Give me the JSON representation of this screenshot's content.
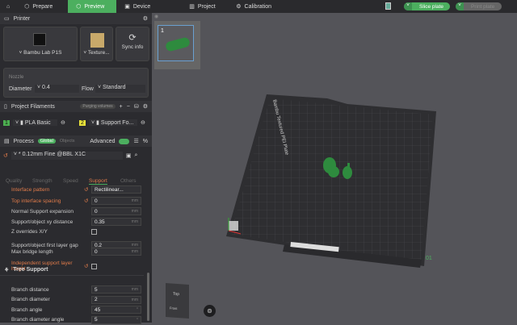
{
  "topbar": {
    "tabs": [
      {
        "label": "Prepare",
        "icon": "cube-icon"
      },
      {
        "label": "Preview",
        "icon": "preview-icon",
        "active": true
      },
      {
        "label": "Device",
        "icon": "device-icon"
      },
      {
        "label": "Project",
        "icon": "project-icon"
      },
      {
        "label": "Calibration",
        "icon": "calibration-icon"
      }
    ],
    "slice_label": "Slice plate",
    "print_label": "Print plate"
  },
  "printer": {
    "title": "Printer",
    "name": "Bambu Lab P1S",
    "plate": "Texture...",
    "sync": "Sync info",
    "nozzle_title": "Nozzle",
    "diameter_label": "Diameter",
    "diameter": "0.4",
    "flow_label": "Flow",
    "flow": "Standard"
  },
  "filaments": {
    "title": "Project Filaments",
    "purging": "Purging volumes",
    "items": [
      {
        "num": "1",
        "name": "PLA Basic",
        "color": "#4caf50"
      },
      {
        "num": "2",
        "name": "Support Fo...",
        "color": "#e8e23a"
      }
    ]
  },
  "process": {
    "title": "Process",
    "global": "Global",
    "objects": "Objects",
    "advanced": "Advanced",
    "preset": "* 0.12mm Fine @BBL X1C",
    "tabs": [
      "Quality",
      "Strength",
      "Speed",
      "Support",
      "Others"
    ],
    "active_tab": "Support"
  },
  "settings": [
    {
      "label": "Interface pattern",
      "value": "Rectilinear...",
      "unit": "",
      "modified": true
    },
    {
      "label": "Top interface spacing",
      "value": "0",
      "unit": "mm",
      "modified": true
    },
    {
      "label": "Normal Support expansion",
      "value": "0",
      "unit": "mm"
    },
    {
      "label": "Support/object xy distance",
      "value": "0.35",
      "unit": "mm"
    },
    {
      "label": "Z overrides X/Y",
      "checkbox": true
    },
    {
      "label": "Support/object first layer gap",
      "value": "0.2",
      "unit": "mm"
    },
    {
      "label": "Max bridge length",
      "value": "0",
      "unit": "mm"
    },
    {
      "label": "Independent support layer height",
      "checkbox": true,
      "modified": true
    }
  ],
  "tree": {
    "title": "Tree Support",
    "items": [
      {
        "label": "Branch distance",
        "value": "5",
        "unit": "mm"
      },
      {
        "label": "Branch diameter",
        "value": "2",
        "unit": "mm"
      },
      {
        "label": "Branch angle",
        "value": "45",
        "unit": "°"
      },
      {
        "label": "Branch diameter angle",
        "value": "5",
        "unit": "°"
      }
    ]
  },
  "viewport": {
    "plate_number": "1",
    "bed_label": "Bambu Textured PEI Plate",
    "plate_index": "01",
    "cube_top": "Top",
    "cube_front": "Front",
    "model_color": "#2e8b3e",
    "accent": "#4caf5f"
  }
}
